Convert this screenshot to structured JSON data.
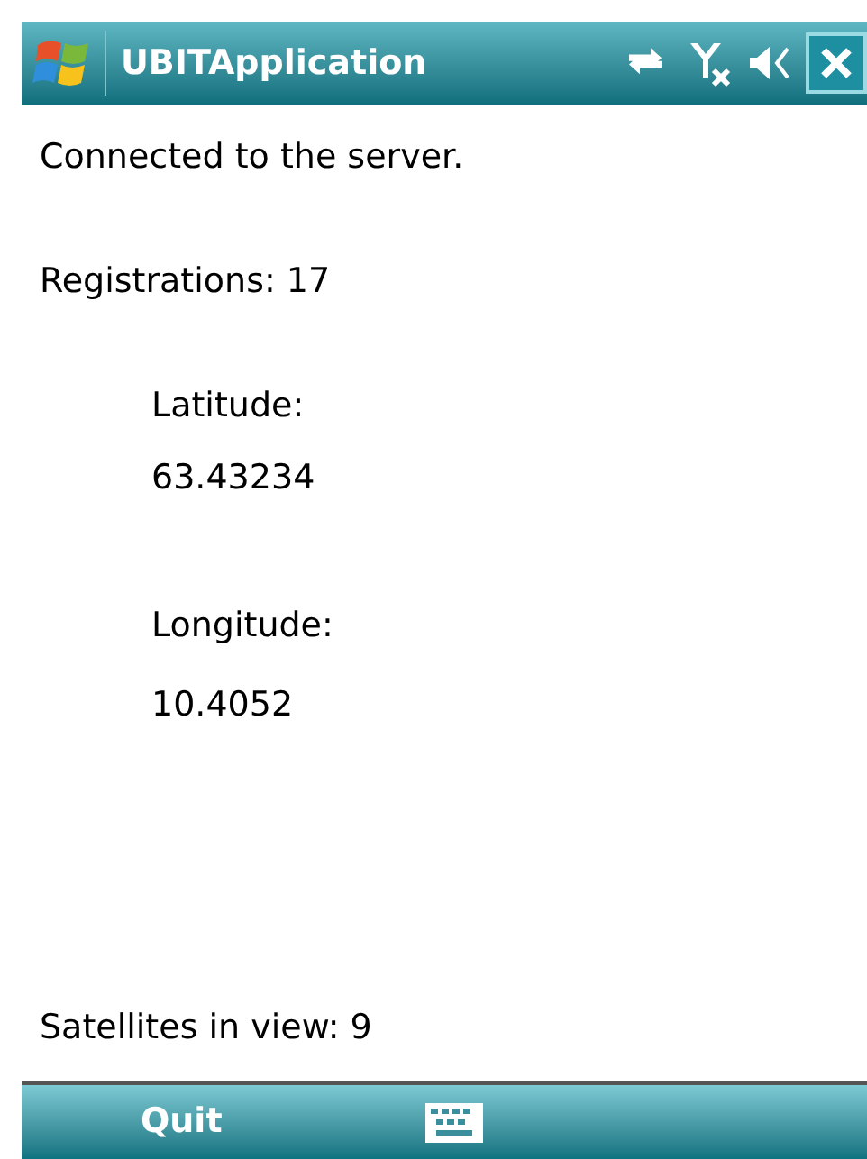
{
  "window": {
    "title": "UBITApplication"
  },
  "content": {
    "status": "Connected to the server.",
    "registrations": "Registrations: 17",
    "latitude_label": "Latitude:",
    "latitude": "63.43234",
    "longitude_label": "Longitude:",
    "longitude": "10.4052",
    "satellites": "Satellites in view: 9"
  },
  "menu_bar": {
    "left_softkey": "Quit"
  }
}
